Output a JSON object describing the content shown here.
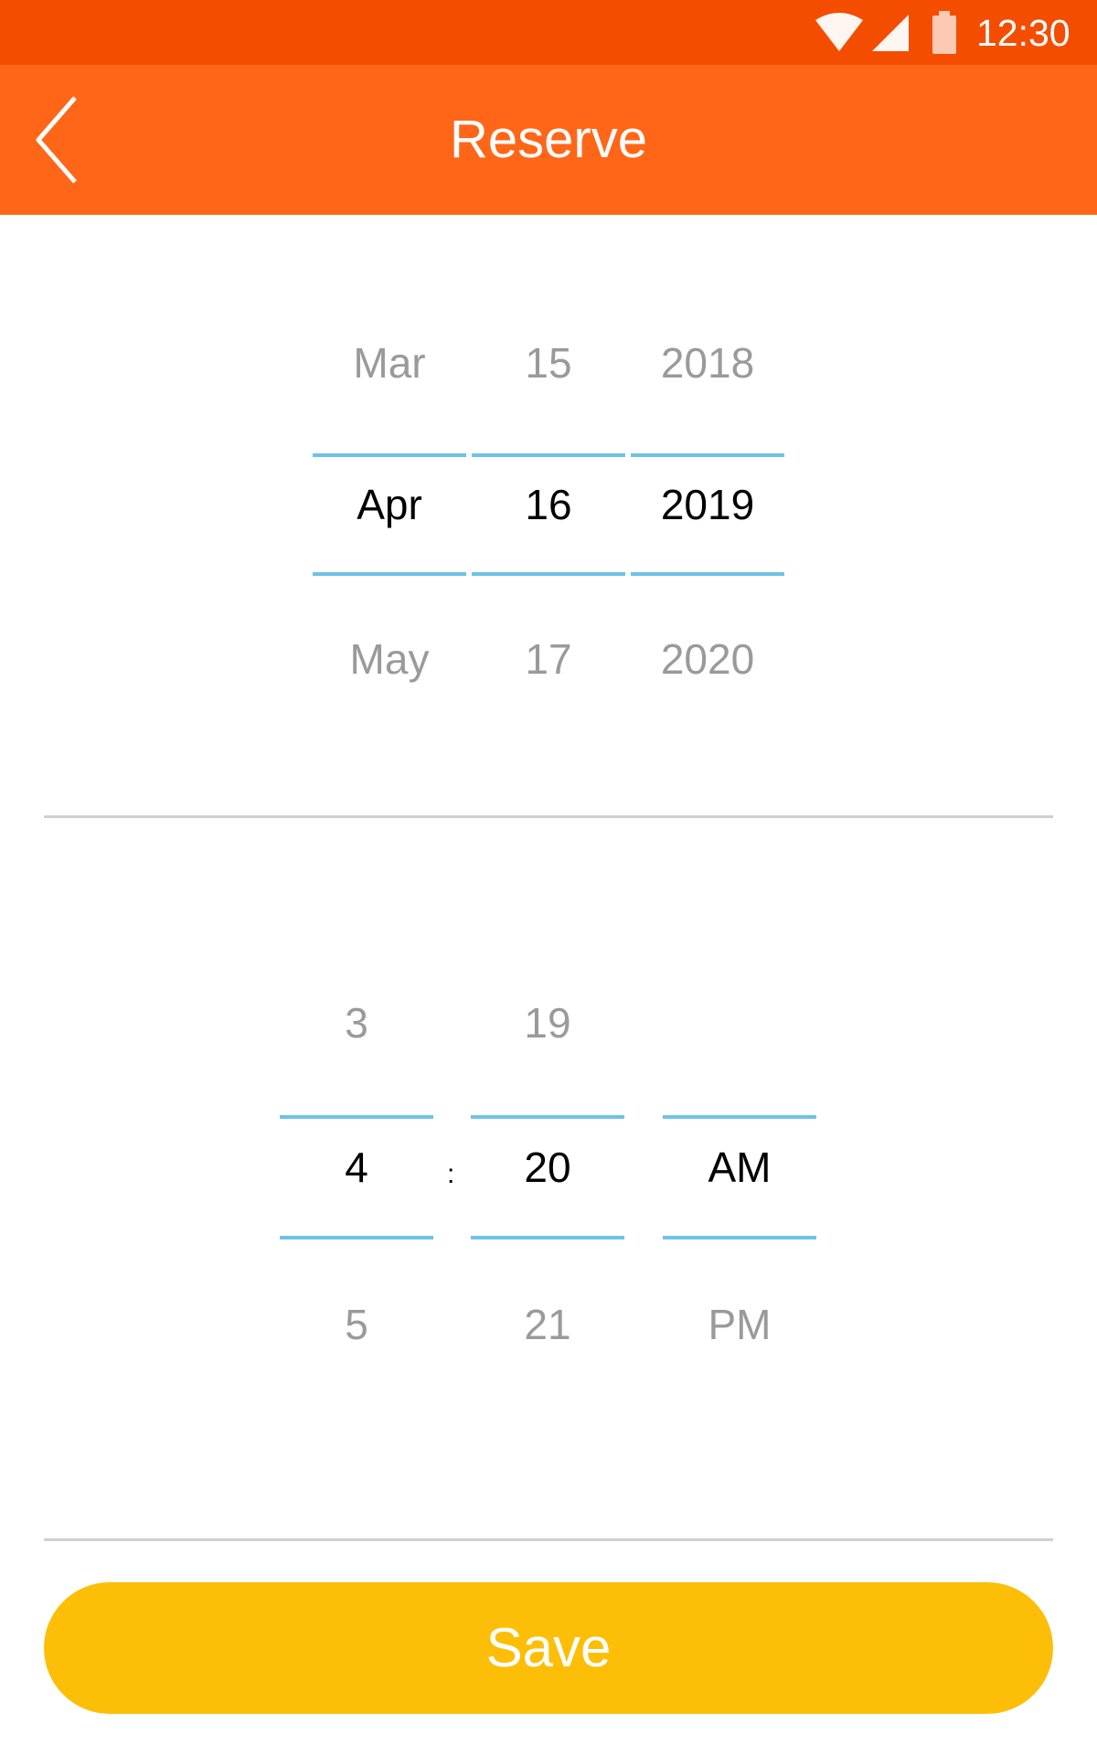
{
  "status_bar": {
    "time": "12:30",
    "icons": [
      "wifi-icon",
      "signal-icon",
      "battery-icon"
    ]
  },
  "app_bar": {
    "title": "Reserve",
    "back_icon": "chevron-left-icon"
  },
  "date_picker": {
    "month": {
      "prev": "Mar",
      "selected": "Apr",
      "next": "May"
    },
    "day": {
      "prev": "15",
      "selected": "16",
      "next": "17"
    },
    "year": {
      "prev": "2018",
      "selected": "2019",
      "next": "2020"
    }
  },
  "time_picker": {
    "hour": {
      "prev": "3",
      "selected": "4",
      "next": "5"
    },
    "separator": ":",
    "minute": {
      "prev": "19",
      "selected": "20",
      "next": "21"
    },
    "period": {
      "prev": "",
      "selected": "AM",
      "next": "PM"
    }
  },
  "save_label": "Save",
  "colors": {
    "status_bar": "#f44d00",
    "app_bar": "#ff6617",
    "selection_line": "#6ec3e6",
    "save_button": "#fdbe08",
    "divider": "#cfcfcf"
  }
}
